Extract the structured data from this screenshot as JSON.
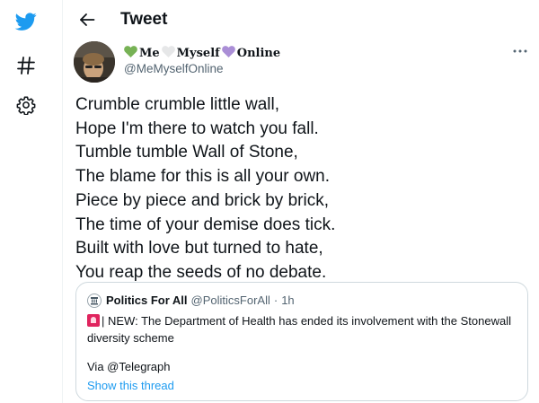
{
  "nav": {
    "icons": [
      "twitter-bird-icon",
      "hashtag-icon",
      "gear-icon"
    ],
    "accent_color": "#1d9bf0"
  },
  "header": {
    "title": "Tweet",
    "back_icon": "arrow-left-icon"
  },
  "tweet": {
    "author": {
      "name_parts": [
        "Me",
        "Myself",
        "Online"
      ],
      "heart_colors": [
        "#77b255",
        "#e6e7e8",
        "#aa8ed6"
      ],
      "handle": "@MeMyselfOnline"
    },
    "lines": [
      "Crumble crumble little wall,",
      "Hope I'm there to watch you fall.",
      "Tumble tumble Wall of Stone,",
      "The blame for this is all your own.",
      "Piece by piece and brick by brick,",
      "The time of your demise does tick.",
      "Built with love but turned to hate,",
      "You reap the seeds of no debate."
    ]
  },
  "quote": {
    "name": "Politics For All",
    "handle": "@PoliticsForAll",
    "separator": "·",
    "time": "1h",
    "text": "| NEW: The Department of Health has ended its involvement with the Stonewall diversity scheme",
    "via": "Via @Telegraph",
    "show_thread": "Show this thread"
  }
}
